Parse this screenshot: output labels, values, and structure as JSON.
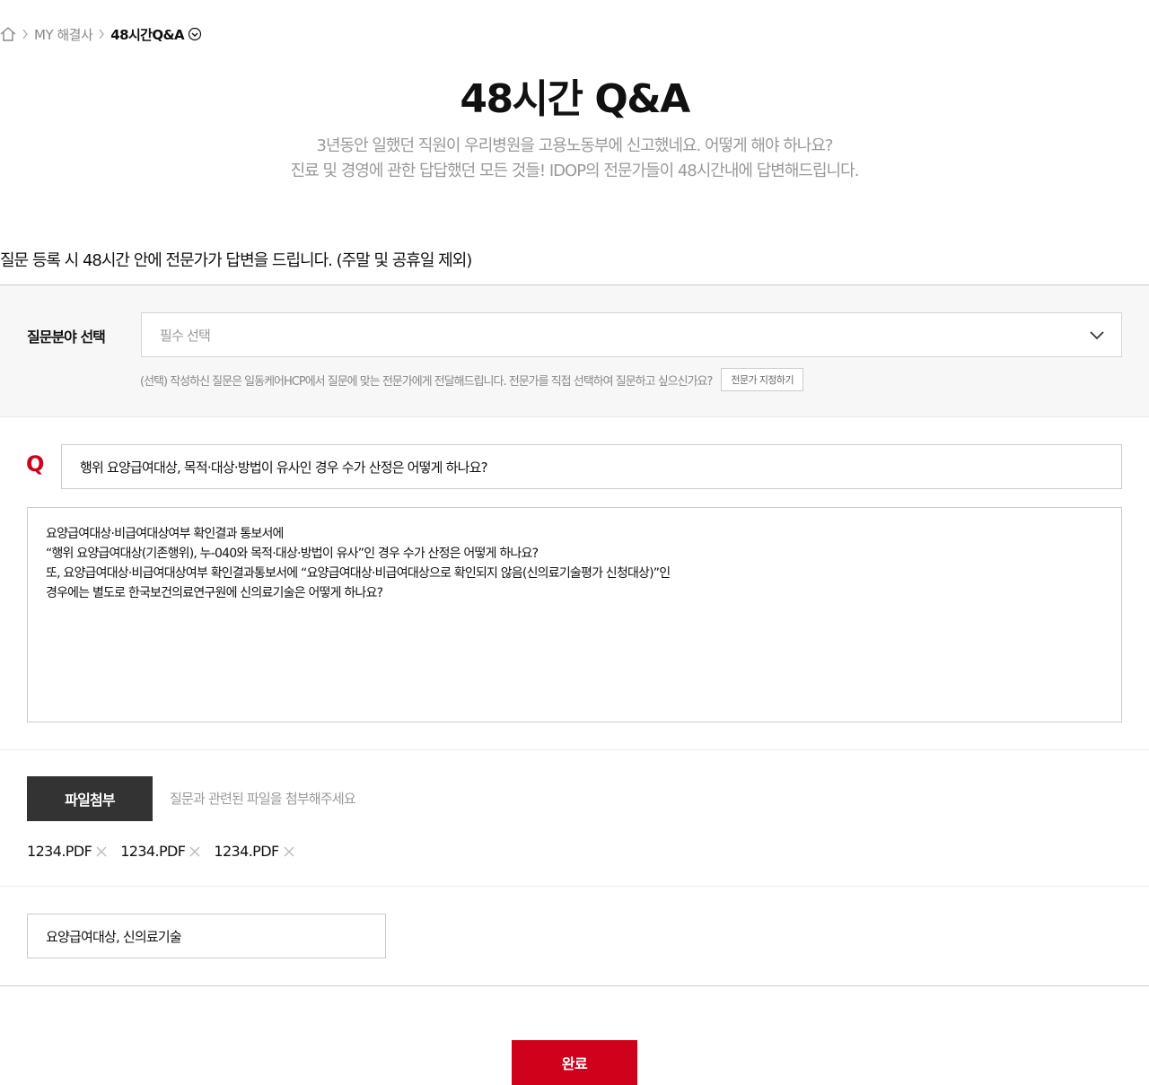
{
  "breadcrumb": {
    "items": [
      "MY 해결사",
      "48시간Q&A"
    ]
  },
  "header": {
    "title": "48시간 Q&A",
    "desc_line1": "3년동안 일했던 직원이 우리병원을 고용노동부에 신고했네요. 어떻게 해야 하나요?",
    "desc_line2": "진료 및 경영에 관한 답답했던 모든 것들! IDOP의 전문가들이 48시간내에 답변해드립니다."
  },
  "notice": "질문 등록 시 48시간 안에 전문가가 답변을 드립니다. (주말 및 공휴일 제외)",
  "category": {
    "label": "질문분야 선택",
    "select_value": "필수 선택",
    "hint": "(선택) 작성하신 질문은 일동케어HCP에서 질문에 맞는 전문가에게 전달해드립니다.  전문가를 직접 선택하여 질문하고 싶으신가요?",
    "expert_button": "전문가 지정하기"
  },
  "question": {
    "mark": "Q",
    "title_value": "행위 요양급여대상, 목적·대상·방법이 유사인 경우 수가 산정은 어떻게 하나요?",
    "body_lines": [
      "요양급여대상·비급여대상여부 확인결과 통보서에",
      "“행위 요양급여대상(기존행위), 누-040와 목적·대상·방법이 유사”인 경우 수가 산정은 어떻게 하나요?",
      "또, 요양급여대상·비급여대상여부 확인결과통보서에 “요양급여대상·비급여대상으로 확인되지 않음(신의료기술평가 신청대상)”인",
      "경우에는 별도로 한국보건의료연구원에 신의료기술은 어떻게 하나요?"
    ]
  },
  "attach": {
    "button": "파일첨부",
    "hint": "질문과 관련된 파일을 첨부해주세요",
    "files": [
      "1234.PDF",
      "1234.PDF",
      "1234.PDF"
    ]
  },
  "tags": {
    "value": "요양급여대상, 신의료기술"
  },
  "submit": {
    "label": "완료"
  },
  "colors": {
    "accent": "#d0021b",
    "dark_button": "#333333",
    "section_bg": "#f7f7f7"
  },
  "icons": [
    "home-icon",
    "chevron-right-icon",
    "chevron-down-circle-icon",
    "chevron-down-icon",
    "close-icon"
  ]
}
